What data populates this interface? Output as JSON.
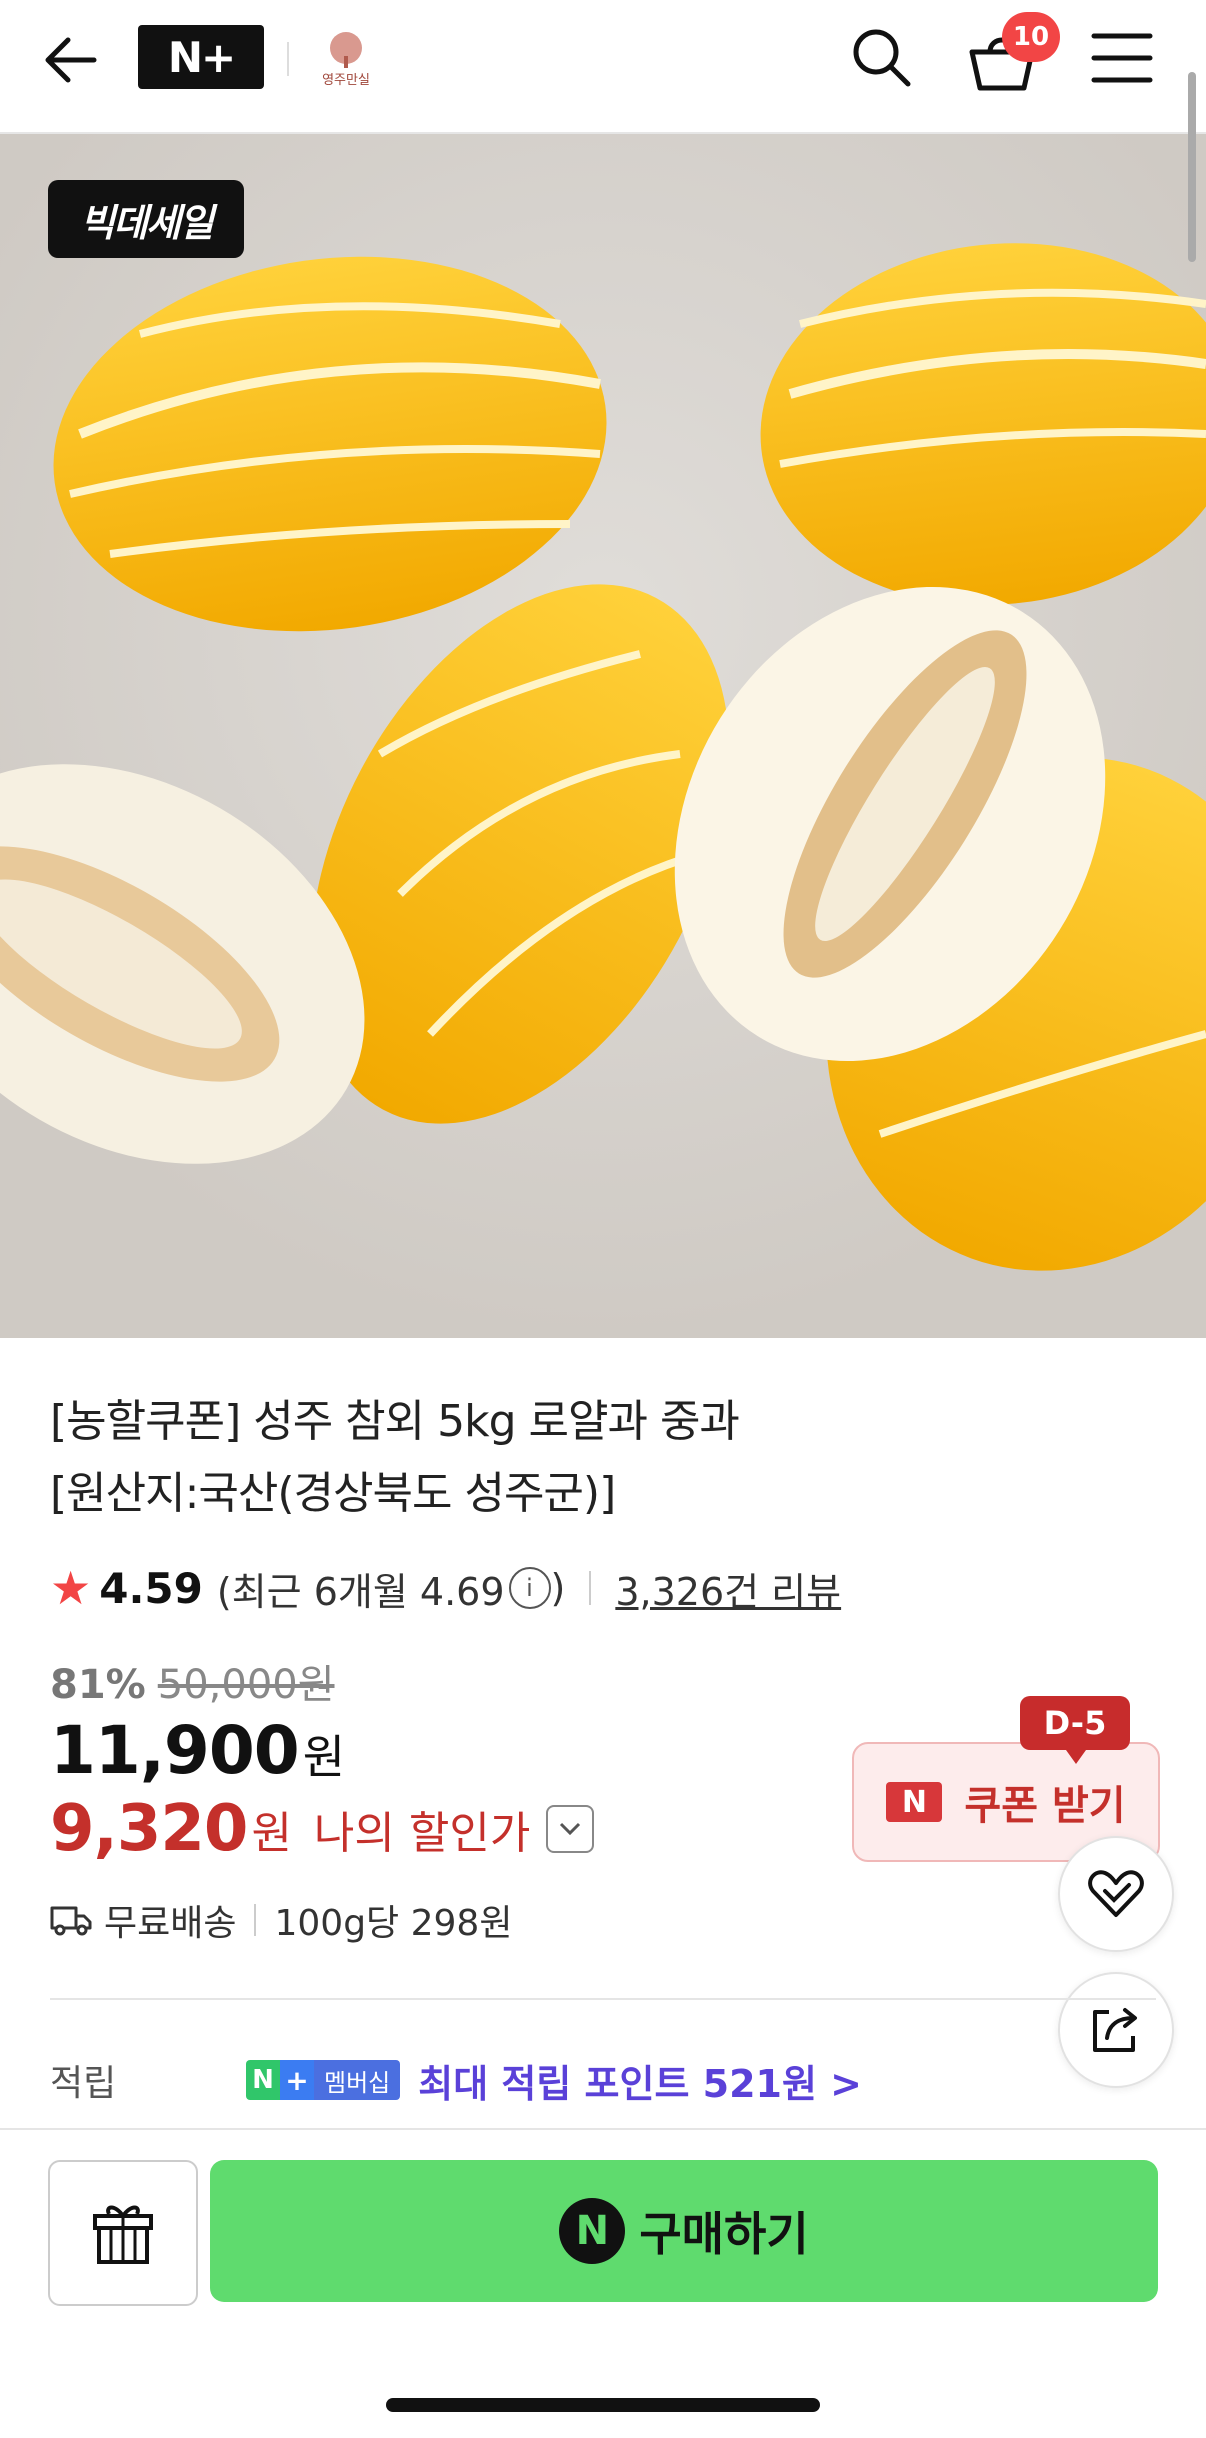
{
  "header": {
    "logo_text": "N+",
    "brand_logo_text": "영주만실",
    "cart_count": "10",
    "icons": [
      "back-arrow-icon",
      "search-icon",
      "cart-icon",
      "menu-icon"
    ]
  },
  "hero": {
    "sale_badge": "빅데세일"
  },
  "product": {
    "title_line1": "[농할쿠폰] 성주 참외 5kg 로얄과 중과",
    "title_line2": "[원산지:국산(경상북도 성주군)]",
    "rating": "4.59",
    "rating_recent": "(최근 6개월 4.69",
    "rating_close": ")",
    "review_count": "3,326건 리뷰",
    "discount_pct": "81%",
    "original_price": "50,000원",
    "price": "11,900",
    "price_unit": "원",
    "my_price": "9,320",
    "my_price_unit": "원",
    "my_price_label": "나의 할인가",
    "shipping": "무료배송",
    "unit_price": "100g당 298원"
  },
  "coupon": {
    "dday": "D-5",
    "n_label": "N",
    "label": "쿠폰 받기"
  },
  "points": {
    "label": "적립",
    "chip_n": "N",
    "chip_plus": "+",
    "chip_member": "멤버십",
    "text": "최대 적립 포인트 521원 >"
  },
  "bottom": {
    "buy_icon_letter": "N",
    "buy_label": "구매하기"
  },
  "colors": {
    "accent_red": "#c4302b",
    "buy_green": "#5fdb6e",
    "point_purple": "#5a41d8"
  }
}
